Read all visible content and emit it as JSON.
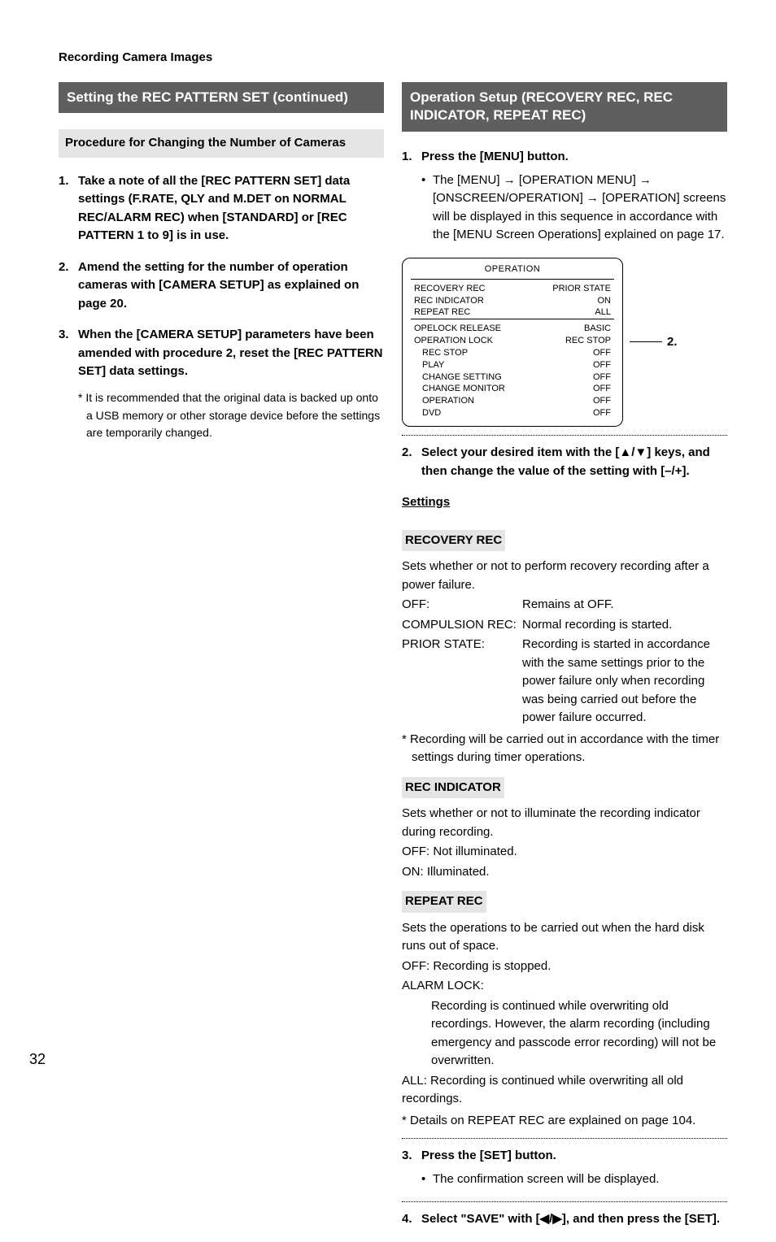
{
  "header": "Recording Camera Images",
  "page_number": "32",
  "left": {
    "bar": "Setting the REC PATTERN SET (continued)",
    "subbar": "Procedure for Changing the Number of Cameras",
    "steps": [
      "Take a note of all the [REC PATTERN SET] data settings (F.RATE, QLY and M.DET on NORMAL REC/ALARM REC) when [STANDARD] or [REC PATTERN 1 to 9] is in use.",
      "Amend the setting for the number of operation cameras with [CAMERA SETUP] as explained on page 20.",
      "When the [CAMERA SETUP] parameters have been amended with procedure 2, reset the [REC PATTERN SET] data settings."
    ],
    "note": "* It is recommended that the original data is backed up onto a USB memory or other storage device before the settings are temporarily changed."
  },
  "right": {
    "bar": "Operation Setup (RECOVERY REC, REC INDICATOR, REPEAT REC)",
    "step1": "Press the [MENU] button.",
    "step1_bullet_a": "The [MENU] ",
    "step1_bullet_b": " [OPERATION MENU] ",
    "step1_bullet_c": " [ONSCREEN/OPERATION] ",
    "step1_bullet_d": " [OPERATION] screens will be displayed in this sequence in accordance with the [MENU Screen Operations] explained on page 17.",
    "diagram": {
      "title": "OPERATION",
      "rows": [
        {
          "k": "RECOVERY REC",
          "v": "PRIOR STATE",
          "sub": false
        },
        {
          "k": "REC INDICATOR",
          "v": "ON",
          "sub": false
        },
        {
          "k": "REPEAT REC",
          "v": "ALL",
          "sub": false
        },
        {
          "k": "OPELOCK RELEASE",
          "v": "BASIC",
          "sub": false,
          "sep_before": true
        },
        {
          "k": "OPERATION LOCK",
          "v": "REC STOP",
          "sub": false
        },
        {
          "k": "REC STOP",
          "v": "OFF",
          "sub": true
        },
        {
          "k": "PLAY",
          "v": "OFF",
          "sub": true
        },
        {
          "k": "CHANGE SETTING",
          "v": "OFF",
          "sub": true
        },
        {
          "k": "CHANGE MONITOR",
          "v": "OFF",
          "sub": true
        },
        {
          "k": "OPERATION",
          "v": "OFF",
          "sub": true
        },
        {
          "k": "DVD",
          "v": "OFF",
          "sub": true
        }
      ],
      "callout": "2."
    },
    "step2_a": "Select your desired item with the [",
    "step2_b": "] keys, and then change the value of the setting with [–/+].",
    "settings_label": "Settings",
    "recovery": {
      "title": "RECOVERY REC",
      "desc": "Sets whether or not to perform recovery recording after a power failure.",
      "off_k": "OFF:",
      "off_v": "Remains at OFF.",
      "comp_k": "COMPULSION REC:",
      "comp_v": "Normal recording is started.",
      "prior_k": "PRIOR STATE:",
      "prior_v": "Recording is started in accordance with the same settings prior to the power failure only when recording was being carried out before the power failure occurred.",
      "footnote": "* Recording will be carried out in accordance with the timer settings during timer operations."
    },
    "indicator": {
      "title": "REC INDICATOR",
      "desc": "Sets whether or not to illuminate the recording indicator during recording.",
      "off": "OFF: Not illuminated.",
      "on": "ON:  Illuminated."
    },
    "repeat": {
      "title": "REPEAT REC",
      "desc": "Sets the operations to be carried out when the hard disk runs out of space.",
      "off": "OFF: Recording is stopped.",
      "alarm_k": "ALARM LOCK:",
      "alarm_v": "Recording is continued while overwriting old recordings. However, the alarm recording (including emergency and passcode error recording) will not be overwritten.",
      "all": "ALL:  Recording is continued while overwriting all old recordings.",
      "footnote": "* Details on REPEAT REC are explained on page 104."
    },
    "step3": "Press the [SET] button.",
    "step3_bullet": "The confirmation screen will be displayed.",
    "step4_a": "Select \"SAVE\" with [",
    "step4_b": "], and then press the [SET]."
  },
  "chart_data": {
    "type": "table",
    "title": "OPERATION",
    "rows": [
      {
        "setting": "RECOVERY REC",
        "value": "PRIOR STATE"
      },
      {
        "setting": "REC INDICATOR",
        "value": "ON"
      },
      {
        "setting": "REPEAT REC",
        "value": "ALL"
      },
      {
        "setting": "OPELOCK RELEASE",
        "value": "BASIC"
      },
      {
        "setting": "OPERATION LOCK",
        "value": "REC STOP"
      },
      {
        "setting": "REC STOP",
        "value": "OFF"
      },
      {
        "setting": "PLAY",
        "value": "OFF"
      },
      {
        "setting": "CHANGE SETTING",
        "value": "OFF"
      },
      {
        "setting": "CHANGE MONITOR",
        "value": "OFF"
      },
      {
        "setting": "OPERATION",
        "value": "OFF"
      },
      {
        "setting": "DVD",
        "value": "OFF"
      }
    ]
  }
}
